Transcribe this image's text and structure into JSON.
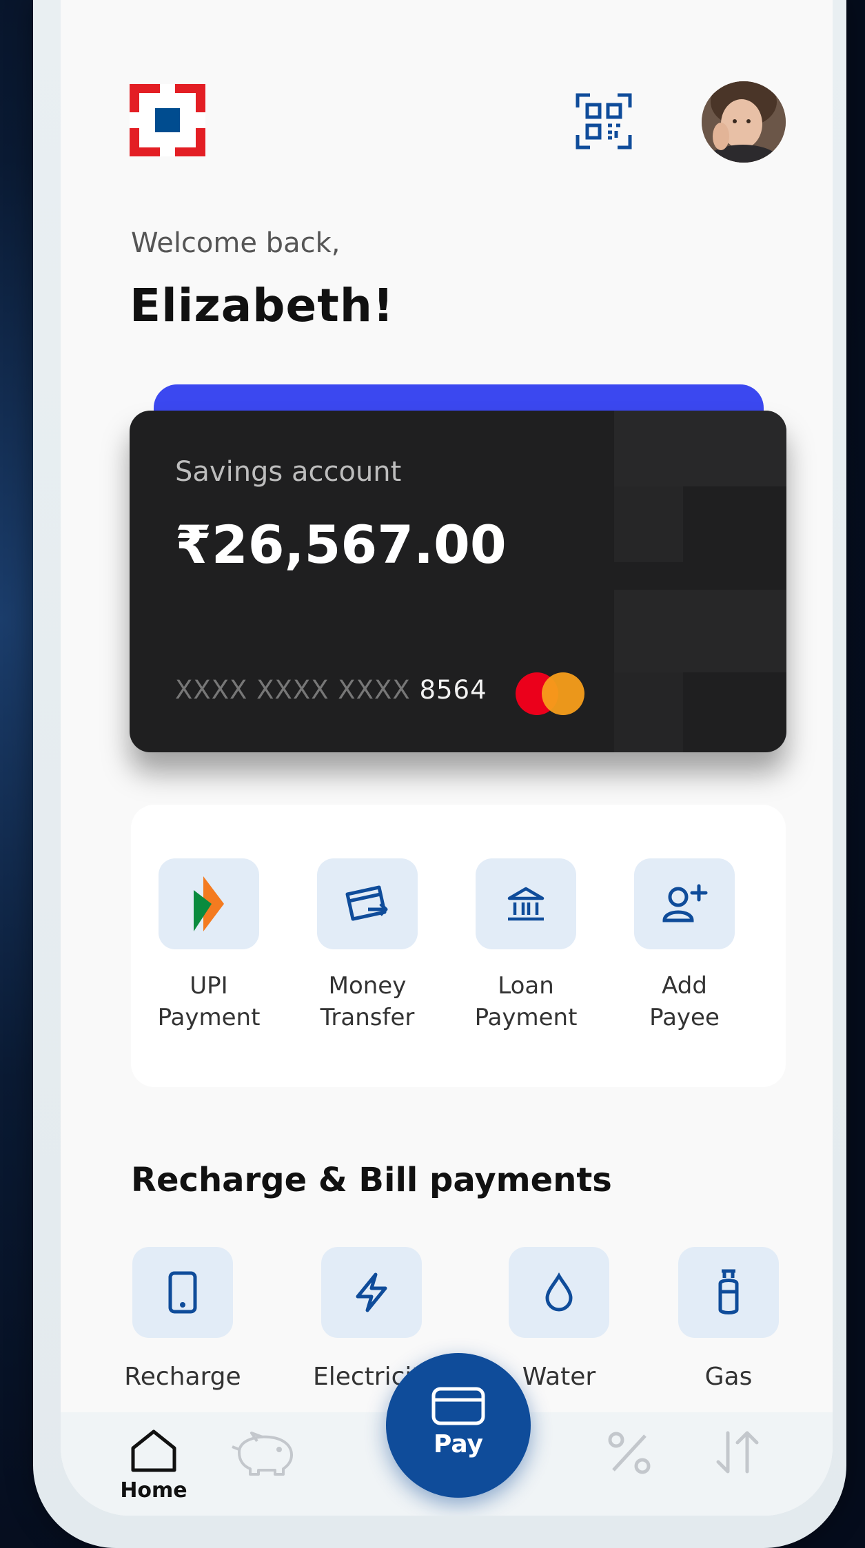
{
  "header": {
    "logo_icon": "bank-logo-icon",
    "qr_icon": "qr-scan-icon",
    "avatar_icon": "user-avatar"
  },
  "greeting": {
    "welcome": "Welcome back,",
    "name": "Elizabeth!"
  },
  "account_card": {
    "type": "Savings account",
    "balance": "₹26,567.00",
    "masked_prefix": "XXXX XXXX XXXX",
    "last_digits": "8564",
    "network_icon": "mastercard-icon"
  },
  "quick_actions": [
    {
      "line1": "UPI",
      "line2": "Payment",
      "icon": "upi-icon"
    },
    {
      "line1": "Money",
      "line2": "Transfer",
      "icon": "card-transfer-icon"
    },
    {
      "line1": "Loan",
      "line2": "Payment",
      "icon": "bank-icon"
    },
    {
      "line1": "Add",
      "line2": "Payee",
      "icon": "add-user-icon"
    }
  ],
  "bill_payments": {
    "title": "Recharge & Bill payments",
    "items": [
      {
        "label": "Recharge",
        "icon": "phone-icon"
      },
      {
        "label": "Electricity",
        "icon": "lightning-icon"
      },
      {
        "label": "Water",
        "icon": "water-drop-icon"
      },
      {
        "label": "Gas",
        "icon": "gas-cylinder-icon"
      }
    ]
  },
  "bottom_nav": {
    "home": "Home",
    "pay": "Pay",
    "items": [
      "home-icon",
      "piggy-bank-icon",
      "percent-icon",
      "transfer-arrows-icon"
    ]
  },
  "colors": {
    "brand_blue": "#0f4c9a",
    "brand_red": "#e31e24",
    "card_accent": "#3b48f0",
    "card_bg": "#1f1f20",
    "tile_bg": "#e2ecf7"
  }
}
